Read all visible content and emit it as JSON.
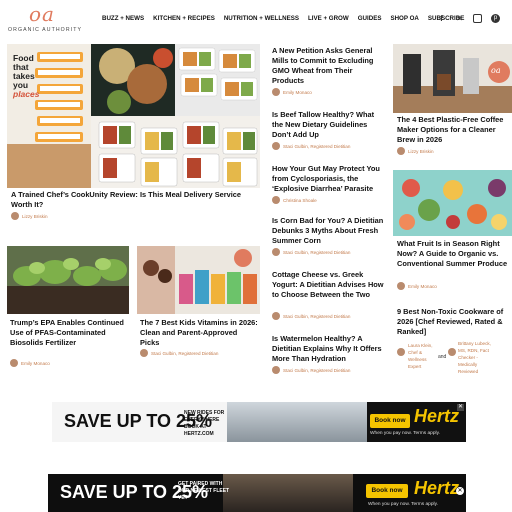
{
  "header": {
    "logo_mark": "oa",
    "logo_text": "ORGANIC AUTHORITY",
    "nav": [
      "BUZZ + NEWS",
      "KITCHEN + RECIPES",
      "NUTRITION + WELLNESS",
      "LIVE + GROW",
      "GUIDES",
      "SHOP OA",
      "SUBSCRIBE"
    ],
    "social_icons": [
      "facebook-icon",
      "x-icon",
      "instagram-icon",
      "pinterest-icon"
    ]
  },
  "hero_image": {
    "box_text": [
      "Food",
      "that",
      "takes",
      "you",
      "places"
    ]
  },
  "left_cards": [
    {
      "title": "A Trained Chef’s CookUnity Review: Is This Meal Delivery Service Worth It?",
      "author": "Lizzy Briskin"
    },
    {
      "title": "Trump’s EPA Enables Continued Use of PFAS-Contaminated Biosolids Fertilizer",
      "author": "Emily Monaco"
    },
    {
      "title": "The 7 Best Kids Vitamins in 2026: Clean and Parent-Approved Picks",
      "author": "Staci Gulbin, Registered Dietitian"
    }
  ],
  "middle_list": [
    {
      "title": "A New Petition Asks General Mills to Commit to Excluding GMO Wheat from Their Products",
      "author": "Emily Monaco"
    },
    {
      "title": "Is Beef Tallow Healthy? What the New Dietary Guidelines Don’t Add Up",
      "author": "Staci Gulbin, Registered Dietitian"
    },
    {
      "title": "How Your Gut May Protect You from Cyclosporiasis, the ‘Explosive Diarrhea’ Parasite",
      "author": "Christina Shoale"
    },
    {
      "title": "Is Corn Bad for You? A Dietitian Debunks 3 Myths About Fresh Summer Corn",
      "author": "Staci Gulbin, Registered Dietitian"
    },
    {
      "title": "Cottage Cheese vs. Greek Yogurt: A Dietitian Advises How to Choose Between the Two",
      "author": "Staci Gulbin, Registered Dietitian"
    },
    {
      "title": "Is Watermelon Healthy? A Dietitian Explains Why It Offers More Than Hydration",
      "author": "Staci Gulbin, Registered Dietitian"
    }
  ],
  "right_cards": [
    {
      "title": "The 4 Best Plastic-Free Coffee Maker Options for a Cleaner Brew in 2026",
      "author": "Lizzy Briskin"
    },
    {
      "title": "What Fruit Is in Season Right Now? A Guide to Organic vs. Conventional Summer Produce",
      "author": "Emily Monaco"
    },
    {
      "title": "9 Best Non-Toxic Cookware of 2026 [Chef Reviewed, Rated & Ranked]",
      "author_a": "Laura Klein, Chef & Wellness Expert",
      "and": "and",
      "author_b": "Brittany Lubeck, MS, RDN, Fact Checker - Medically Reviewed"
    }
  ],
  "ads": [
    {
      "headline": "SAVE UP TO 25%",
      "sub": "NEW RIDES FOR EVERYWHERE BOOK AT HERTZ.COM",
      "button": "Book now",
      "brand": "Hertz",
      "tagline": "When you pay now. Terms apply."
    },
    {
      "headline": "SAVE UP TO 25%",
      "sub": "GET PAIRED WITH OUR NEWEST FLEET YET",
      "button": "Book now",
      "brand": "Hertz",
      "tagline": "When you pay now. Terms apply."
    }
  ],
  "colors": {
    "accent": "#e07b5f",
    "byline": "#c27a4b",
    "ad_yellow": "#f5c400"
  }
}
